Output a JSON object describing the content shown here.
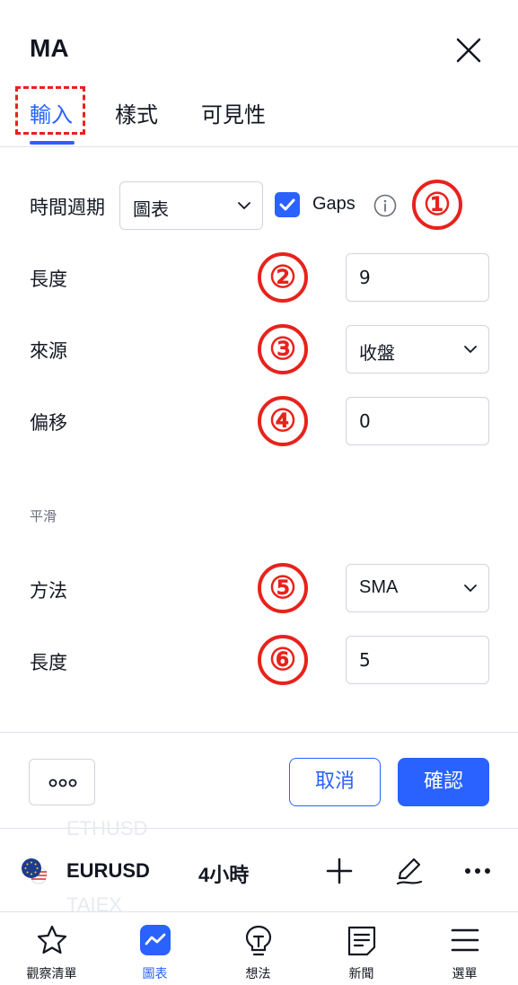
{
  "dialog": {
    "title": "MA"
  },
  "tabs": [
    {
      "label": "輸入",
      "active": true
    },
    {
      "label": "樣式",
      "active": false
    },
    {
      "label": "可見性",
      "active": false
    }
  ],
  "inputs": {
    "timeframe": {
      "label": "時間週期",
      "value": "圖表"
    },
    "gaps": {
      "label": "Gaps",
      "checked": true
    },
    "length": {
      "label": "長度",
      "value": "9"
    },
    "source": {
      "label": "來源",
      "value": "收盤"
    },
    "offset": {
      "label": "偏移",
      "value": "0"
    }
  },
  "smoothing": {
    "section_label": "平滑",
    "method": {
      "label": "方法",
      "value": "SMA"
    },
    "length": {
      "label": "長度",
      "value": "5"
    }
  },
  "annotations": [
    "①",
    "②",
    "③",
    "④",
    "⑤",
    "⑥"
  ],
  "footer": {
    "cancel_label": "取消",
    "confirm_label": "確認"
  },
  "symbol_bar": {
    "symbol": "EURUSD",
    "interval": "4小時",
    "ghost_above": "ETHUSD",
    "ghost_below": "TAIEX"
  },
  "nav": [
    {
      "label": "觀察清單",
      "icon": "star-icon",
      "active": false
    },
    {
      "label": "圖表",
      "icon": "chart-icon",
      "active": true
    },
    {
      "label": "想法",
      "icon": "bulb-icon",
      "active": false
    },
    {
      "label": "新聞",
      "icon": "news-icon",
      "active": false
    },
    {
      "label": "選單",
      "icon": "menu-icon",
      "active": false
    }
  ],
  "colors": {
    "accent": "#2962ff",
    "annotation": "#e8221c",
    "text": "#131722",
    "muted": "#6a6d78",
    "border": "#d1d4dc"
  }
}
